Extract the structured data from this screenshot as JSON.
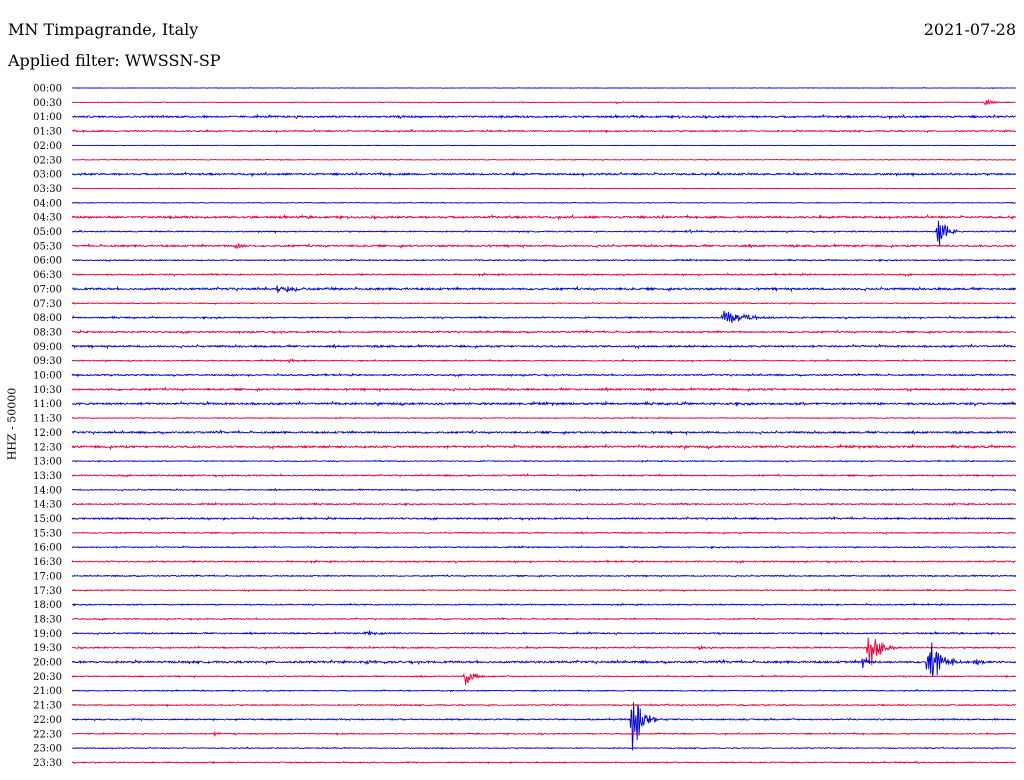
{
  "header": {
    "station": "MN Timpagrande, Italy",
    "date": "2021-07-28",
    "filter": "Applied filter: WWSSN-SP",
    "channel": "HHZ - 50000"
  },
  "colors": {
    "even_hour": "#0000cc",
    "odd_half": "#e8003a",
    "background": "#ffffff"
  },
  "chart_data": {
    "type": "line",
    "title": "MN Timpagrande, Italy",
    "subtitle": "Applied filter: WWSSN-SP",
    "ylabel": "HHZ - 50000",
    "trace_labels": [
      "00:00",
      "00:30",
      "01:00",
      "01:30",
      "02:00",
      "02:30",
      "03:00",
      "03:30",
      "04:00",
      "04:30",
      "05:00",
      "05:30",
      "06:00",
      "06:30",
      "07:00",
      "07:30",
      "08:00",
      "08:30",
      "09:00",
      "09:30",
      "10:00",
      "10:30",
      "11:00",
      "11:30",
      "12:00",
      "12:30",
      "13:00",
      "13:30",
      "14:00",
      "14:30",
      "15:00",
      "15:30",
      "16:00",
      "16:30",
      "17:00",
      "17:30",
      "18:00",
      "18:30",
      "19:00",
      "19:30",
      "20:00",
      "20:30",
      "21:00",
      "21:30",
      "22:00",
      "22:30",
      "23:00",
      "23:30"
    ],
    "trace_minutes": 30,
    "noise_level": [
      0.2,
      0.3,
      0.8,
      0.6,
      0.2,
      0.3,
      0.8,
      0.3,
      0.3,
      0.9,
      0.5,
      0.8,
      0.5,
      0.6,
      0.9,
      0.4,
      0.6,
      0.7,
      0.8,
      0.5,
      0.6,
      0.8,
      0.9,
      0.4,
      0.8,
      0.9,
      0.4,
      0.6,
      0.5,
      0.6,
      0.7,
      0.5,
      0.5,
      0.6,
      0.5,
      0.5,
      0.5,
      0.5,
      0.6,
      0.6,
      0.9,
      0.5,
      0.4,
      0.5,
      0.6,
      0.5,
      0.4,
      0.5
    ],
    "events": [
      {
        "trace": 1,
        "minute": 17.3,
        "amplitude": 2,
        "duration_min": 0.5
      },
      {
        "trace": 1,
        "minute": 29.0,
        "amplitude": 3,
        "duration_min": 0.8
      },
      {
        "trace": 10,
        "minute": 19.5,
        "amplitude": 2,
        "duration_min": 1.5
      },
      {
        "trace": 10,
        "minute": 27.5,
        "amplitude": 20,
        "duration_min": 0.7
      },
      {
        "trace": 11,
        "minute": 5.2,
        "amplitude": 5,
        "duration_min": 0.5
      },
      {
        "trace": 14,
        "minute": 6.5,
        "amplitude": 5,
        "duration_min": 1.5
      },
      {
        "trace": 16,
        "minute": 20.7,
        "amplitude": 8,
        "duration_min": 1.8
      },
      {
        "trace": 19,
        "minute": 6.9,
        "amplitude": 3,
        "duration_min": 0.7
      },
      {
        "trace": 20,
        "minute": 1.0,
        "amplitude": 2,
        "duration_min": 0.6
      },
      {
        "trace": 38,
        "minute": 9.3,
        "amplitude": 3,
        "duration_min": 1.2
      },
      {
        "trace": 39,
        "minute": 19.9,
        "amplitude": 3,
        "duration_min": 0.5
      },
      {
        "trace": 39,
        "minute": 25.3,
        "amplitude": 24,
        "duration_min": 0.9
      },
      {
        "trace": 40,
        "minute": 9.3,
        "amplitude": 4,
        "duration_min": 0.7
      },
      {
        "trace": 40,
        "minute": 25.1,
        "amplitude": 12,
        "duration_min": 0.4
      },
      {
        "trace": 40,
        "minute": 27.2,
        "amplitude": 28,
        "duration_min": 1.0
      },
      {
        "trace": 40,
        "minute": 28.7,
        "amplitude": 5,
        "duration_min": 0.5
      },
      {
        "trace": 41,
        "minute": 12.5,
        "amplitude": 11,
        "duration_min": 0.6
      },
      {
        "trace": 44,
        "minute": 17.8,
        "amplitude": 36,
        "duration_min": 0.8
      },
      {
        "trace": 45,
        "minute": 4.5,
        "amplitude": 3,
        "duration_min": 0.4
      }
    ]
  }
}
